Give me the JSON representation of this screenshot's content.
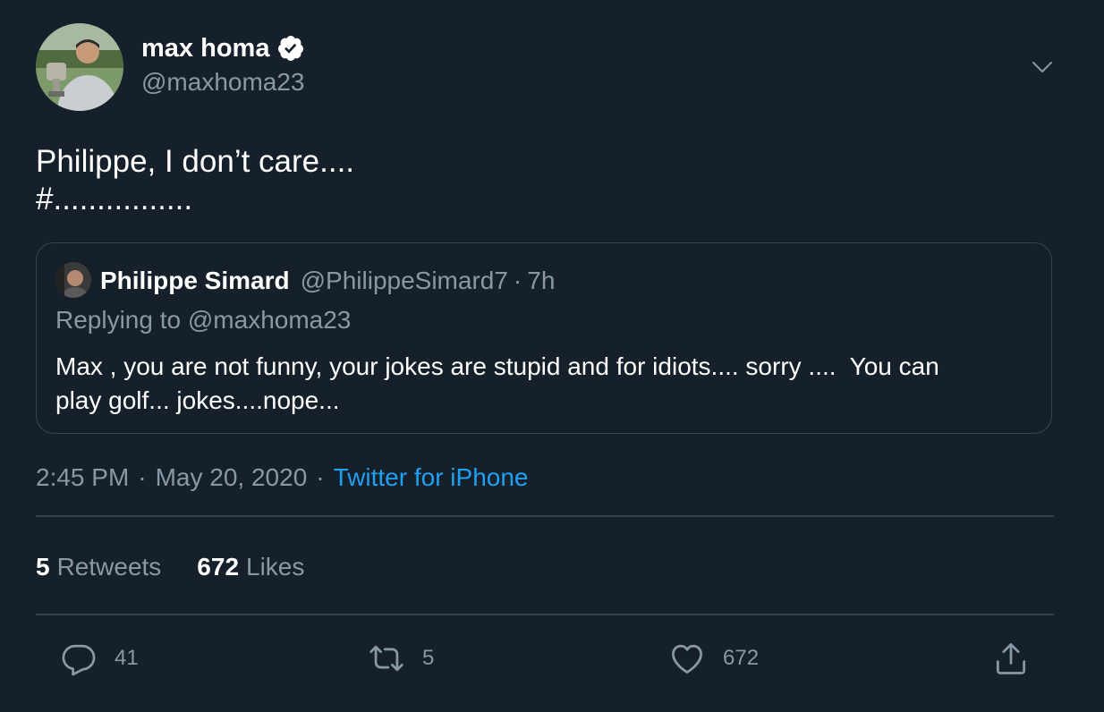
{
  "author": {
    "name": "max homa",
    "handle": "@maxhoma23",
    "verified": true
  },
  "tweet": {
    "lines": [
      "Philippe, I don’t care....",
      "#................"
    ]
  },
  "quoted": {
    "name": "Philippe Simard",
    "handle": "@PhilippeSimard7",
    "separator": "·",
    "time": "7h",
    "replying_prefix": "Replying to",
    "replying_to": "@maxhoma23",
    "lines": [
      "Max , you are not funny, your jokes are stupid and for idiots.... sorry ....  You can",
      "play golf... jokes....nope..."
    ]
  },
  "meta": {
    "time": "2:45 PM",
    "separator": "·",
    "date": "May 20, 2020",
    "source": "Twitter for iPhone"
  },
  "stats": {
    "retweets_count": "5",
    "retweets_label": "Retweets",
    "likes_count": "672",
    "likes_label": "Likes"
  },
  "actions": {
    "reply_count": "41",
    "retweet_count": "5",
    "like_count": "672",
    "icons": {
      "reply": "reply-icon",
      "retweet": "retweet-icon",
      "like": "heart-icon",
      "share": "share-icon",
      "caret": "chevron-down-icon",
      "verified": "verified-badge-icon"
    }
  },
  "colors": {
    "background": "#15202b",
    "text": "#ffffff",
    "secondary": "#8899a6",
    "accent": "#1da1f2",
    "border": "#38444d"
  }
}
